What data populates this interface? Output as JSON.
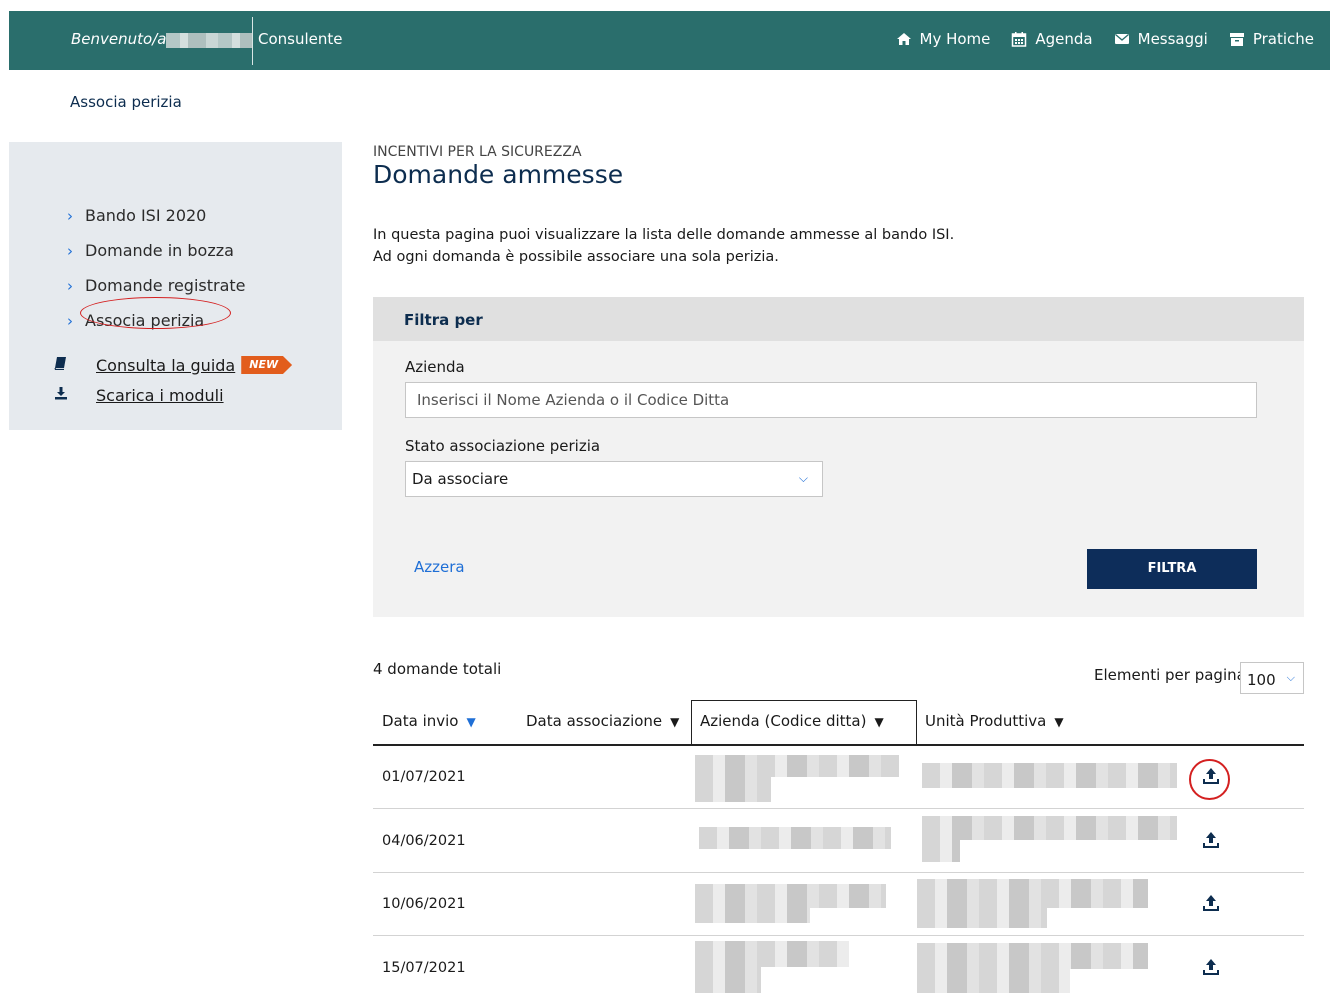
{
  "header": {
    "welcome": "Benvenuto/a",
    "role": "Consulente",
    "nav": [
      {
        "label": "My Home",
        "icon": "home-icon"
      },
      {
        "label": "Agenda",
        "icon": "calendar-icon"
      },
      {
        "label": "Messaggi",
        "icon": "envelope-icon"
      },
      {
        "label": "Pratiche",
        "icon": "archive-icon"
      }
    ],
    "bg_color": "#2a6e6c"
  },
  "breadcrumb": "Associa perizia",
  "sidebar": {
    "items": [
      {
        "label": "Bando ISI 2020"
      },
      {
        "label": "Domande in bozza"
      },
      {
        "label": "Domande registrate"
      },
      {
        "label": "Associa perizia",
        "active": true
      }
    ],
    "links": [
      {
        "label": "Consulta la guida",
        "icon": "book-icon",
        "badge": "NEW"
      },
      {
        "label": "Scarica i moduli",
        "icon": "download-icon"
      }
    ]
  },
  "main": {
    "section_label": "INCENTIVI PER LA SICUREZZA",
    "title": "Domande ammesse",
    "intro_line1": "In questa pagina puoi visualizzare la lista delle domande ammesse al bando ISI.",
    "intro_line2": "Ad ogni domanda è possibile associare una sola perizia."
  },
  "filter": {
    "heading": "Filtra per",
    "azienda_label": "Azienda",
    "azienda_placeholder": "Inserisci il Nome Azienda o il Codice Ditta",
    "stato_label": "Stato associazione perizia",
    "stato_value": "Da associare",
    "reset_label": "Azzera",
    "submit_label": "FILTRA"
  },
  "table": {
    "total": "4 domande totali",
    "per_page_label": "Elementi per pagina",
    "per_page_value": "100",
    "columns": [
      "Data invio",
      "Data associazione",
      "Azienda (Codice ditta)",
      "Unità Produttiva"
    ],
    "rows": [
      {
        "date": "01/07/2021"
      },
      {
        "date": "04/06/2021"
      },
      {
        "date": "10/06/2021"
      },
      {
        "date": "15/07/2021"
      }
    ]
  },
  "colors": {
    "navy": "#0d2d5a",
    "link_blue": "#1f6fd6",
    "highlight_red": "#d42020",
    "new_badge": "#e25d1c"
  }
}
